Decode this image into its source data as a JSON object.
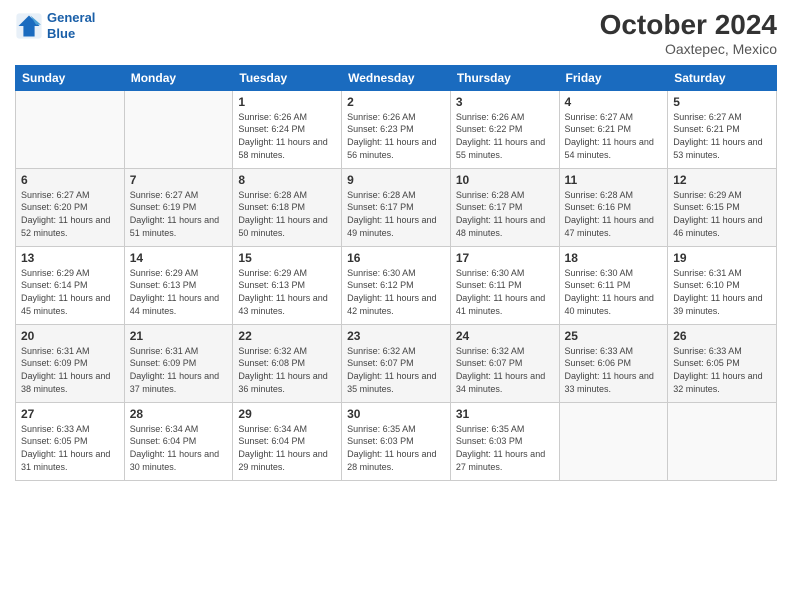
{
  "header": {
    "logo_line1": "General",
    "logo_line2": "Blue",
    "month": "October 2024",
    "location": "Oaxtepec, Mexico"
  },
  "weekdays": [
    "Sunday",
    "Monday",
    "Tuesday",
    "Wednesday",
    "Thursday",
    "Friday",
    "Saturday"
  ],
  "weeks": [
    [
      {
        "day": "",
        "info": ""
      },
      {
        "day": "",
        "info": ""
      },
      {
        "day": "1",
        "info": "Sunrise: 6:26 AM\nSunset: 6:24 PM\nDaylight: 11 hours and 58 minutes."
      },
      {
        "day": "2",
        "info": "Sunrise: 6:26 AM\nSunset: 6:23 PM\nDaylight: 11 hours and 56 minutes."
      },
      {
        "day": "3",
        "info": "Sunrise: 6:26 AM\nSunset: 6:22 PM\nDaylight: 11 hours and 55 minutes."
      },
      {
        "day": "4",
        "info": "Sunrise: 6:27 AM\nSunset: 6:21 PM\nDaylight: 11 hours and 54 minutes."
      },
      {
        "day": "5",
        "info": "Sunrise: 6:27 AM\nSunset: 6:21 PM\nDaylight: 11 hours and 53 minutes."
      }
    ],
    [
      {
        "day": "6",
        "info": "Sunrise: 6:27 AM\nSunset: 6:20 PM\nDaylight: 11 hours and 52 minutes."
      },
      {
        "day": "7",
        "info": "Sunrise: 6:27 AM\nSunset: 6:19 PM\nDaylight: 11 hours and 51 minutes."
      },
      {
        "day": "8",
        "info": "Sunrise: 6:28 AM\nSunset: 6:18 PM\nDaylight: 11 hours and 50 minutes."
      },
      {
        "day": "9",
        "info": "Sunrise: 6:28 AM\nSunset: 6:17 PM\nDaylight: 11 hours and 49 minutes."
      },
      {
        "day": "10",
        "info": "Sunrise: 6:28 AM\nSunset: 6:17 PM\nDaylight: 11 hours and 48 minutes."
      },
      {
        "day": "11",
        "info": "Sunrise: 6:28 AM\nSunset: 6:16 PM\nDaylight: 11 hours and 47 minutes."
      },
      {
        "day": "12",
        "info": "Sunrise: 6:29 AM\nSunset: 6:15 PM\nDaylight: 11 hours and 46 minutes."
      }
    ],
    [
      {
        "day": "13",
        "info": "Sunrise: 6:29 AM\nSunset: 6:14 PM\nDaylight: 11 hours and 45 minutes."
      },
      {
        "day": "14",
        "info": "Sunrise: 6:29 AM\nSunset: 6:13 PM\nDaylight: 11 hours and 44 minutes."
      },
      {
        "day": "15",
        "info": "Sunrise: 6:29 AM\nSunset: 6:13 PM\nDaylight: 11 hours and 43 minutes."
      },
      {
        "day": "16",
        "info": "Sunrise: 6:30 AM\nSunset: 6:12 PM\nDaylight: 11 hours and 42 minutes."
      },
      {
        "day": "17",
        "info": "Sunrise: 6:30 AM\nSunset: 6:11 PM\nDaylight: 11 hours and 41 minutes."
      },
      {
        "day": "18",
        "info": "Sunrise: 6:30 AM\nSunset: 6:11 PM\nDaylight: 11 hours and 40 minutes."
      },
      {
        "day": "19",
        "info": "Sunrise: 6:31 AM\nSunset: 6:10 PM\nDaylight: 11 hours and 39 minutes."
      }
    ],
    [
      {
        "day": "20",
        "info": "Sunrise: 6:31 AM\nSunset: 6:09 PM\nDaylight: 11 hours and 38 minutes."
      },
      {
        "day": "21",
        "info": "Sunrise: 6:31 AM\nSunset: 6:09 PM\nDaylight: 11 hours and 37 minutes."
      },
      {
        "day": "22",
        "info": "Sunrise: 6:32 AM\nSunset: 6:08 PM\nDaylight: 11 hours and 36 minutes."
      },
      {
        "day": "23",
        "info": "Sunrise: 6:32 AM\nSunset: 6:07 PM\nDaylight: 11 hours and 35 minutes."
      },
      {
        "day": "24",
        "info": "Sunrise: 6:32 AM\nSunset: 6:07 PM\nDaylight: 11 hours and 34 minutes."
      },
      {
        "day": "25",
        "info": "Sunrise: 6:33 AM\nSunset: 6:06 PM\nDaylight: 11 hours and 33 minutes."
      },
      {
        "day": "26",
        "info": "Sunrise: 6:33 AM\nSunset: 6:05 PM\nDaylight: 11 hours and 32 minutes."
      }
    ],
    [
      {
        "day": "27",
        "info": "Sunrise: 6:33 AM\nSunset: 6:05 PM\nDaylight: 11 hours and 31 minutes."
      },
      {
        "day": "28",
        "info": "Sunrise: 6:34 AM\nSunset: 6:04 PM\nDaylight: 11 hours and 30 minutes."
      },
      {
        "day": "29",
        "info": "Sunrise: 6:34 AM\nSunset: 6:04 PM\nDaylight: 11 hours and 29 minutes."
      },
      {
        "day": "30",
        "info": "Sunrise: 6:35 AM\nSunset: 6:03 PM\nDaylight: 11 hours and 28 minutes."
      },
      {
        "day": "31",
        "info": "Sunrise: 6:35 AM\nSunset: 6:03 PM\nDaylight: 11 hours and 27 minutes."
      },
      {
        "day": "",
        "info": ""
      },
      {
        "day": "",
        "info": ""
      }
    ]
  ]
}
